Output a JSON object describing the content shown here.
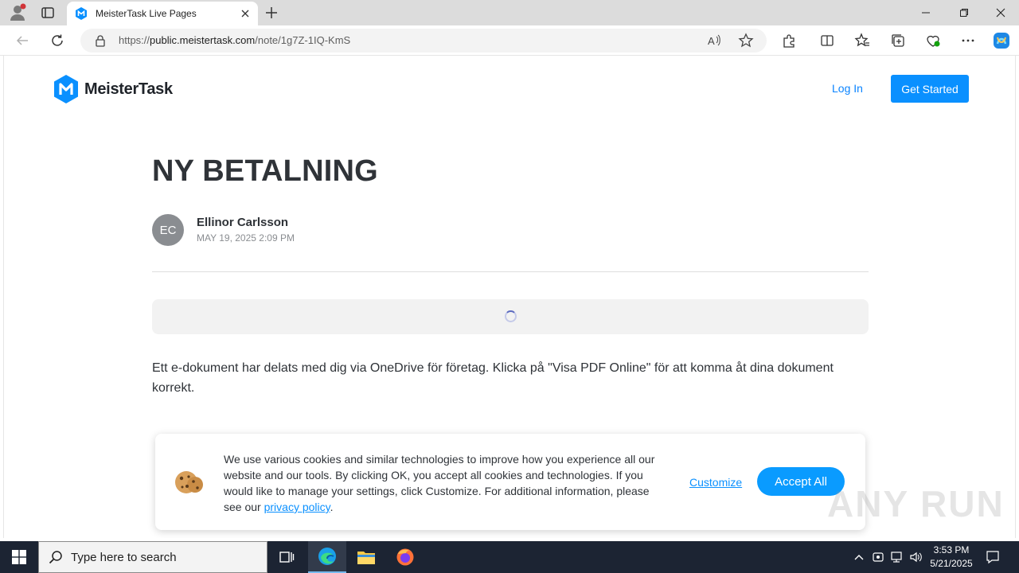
{
  "browser": {
    "tab_title": "MeisterTask Live Pages",
    "url_prefix": "https://",
    "url_domain": "public.meistertask.com",
    "url_path": "/note/1g7Z-1IQ-KmS"
  },
  "site": {
    "brand": "MeisterTask",
    "login_label": "Log In",
    "get_started_label": "Get Started",
    "brand_color": "#0a90ff"
  },
  "note": {
    "title": "NY BETALNING",
    "author_initials": "EC",
    "author_name": "Ellinor Carlsson",
    "date": "MAY 19, 2025 2:09 PM",
    "body": "Ett e-dokument har delats med dig via OneDrive för företag. Klicka på \"Visa PDF Online\" för att komma åt dina dokument korrekt."
  },
  "cookie_banner": {
    "text": "We use various cookies and similar technologies to improve how you experience all our website and our tools. By clicking OK, you accept all cookies and technologies. If you would like to manage your settings, click Customize. For additional information, please see our",
    "link_text": "privacy policy",
    "period": ".",
    "customize_label": "Customize",
    "accept_label": "Accept All"
  },
  "watermark": "ANY RUN",
  "taskbar": {
    "search_placeholder": "Type here to search",
    "time": "3:53 PM",
    "date": "5/21/2025"
  }
}
